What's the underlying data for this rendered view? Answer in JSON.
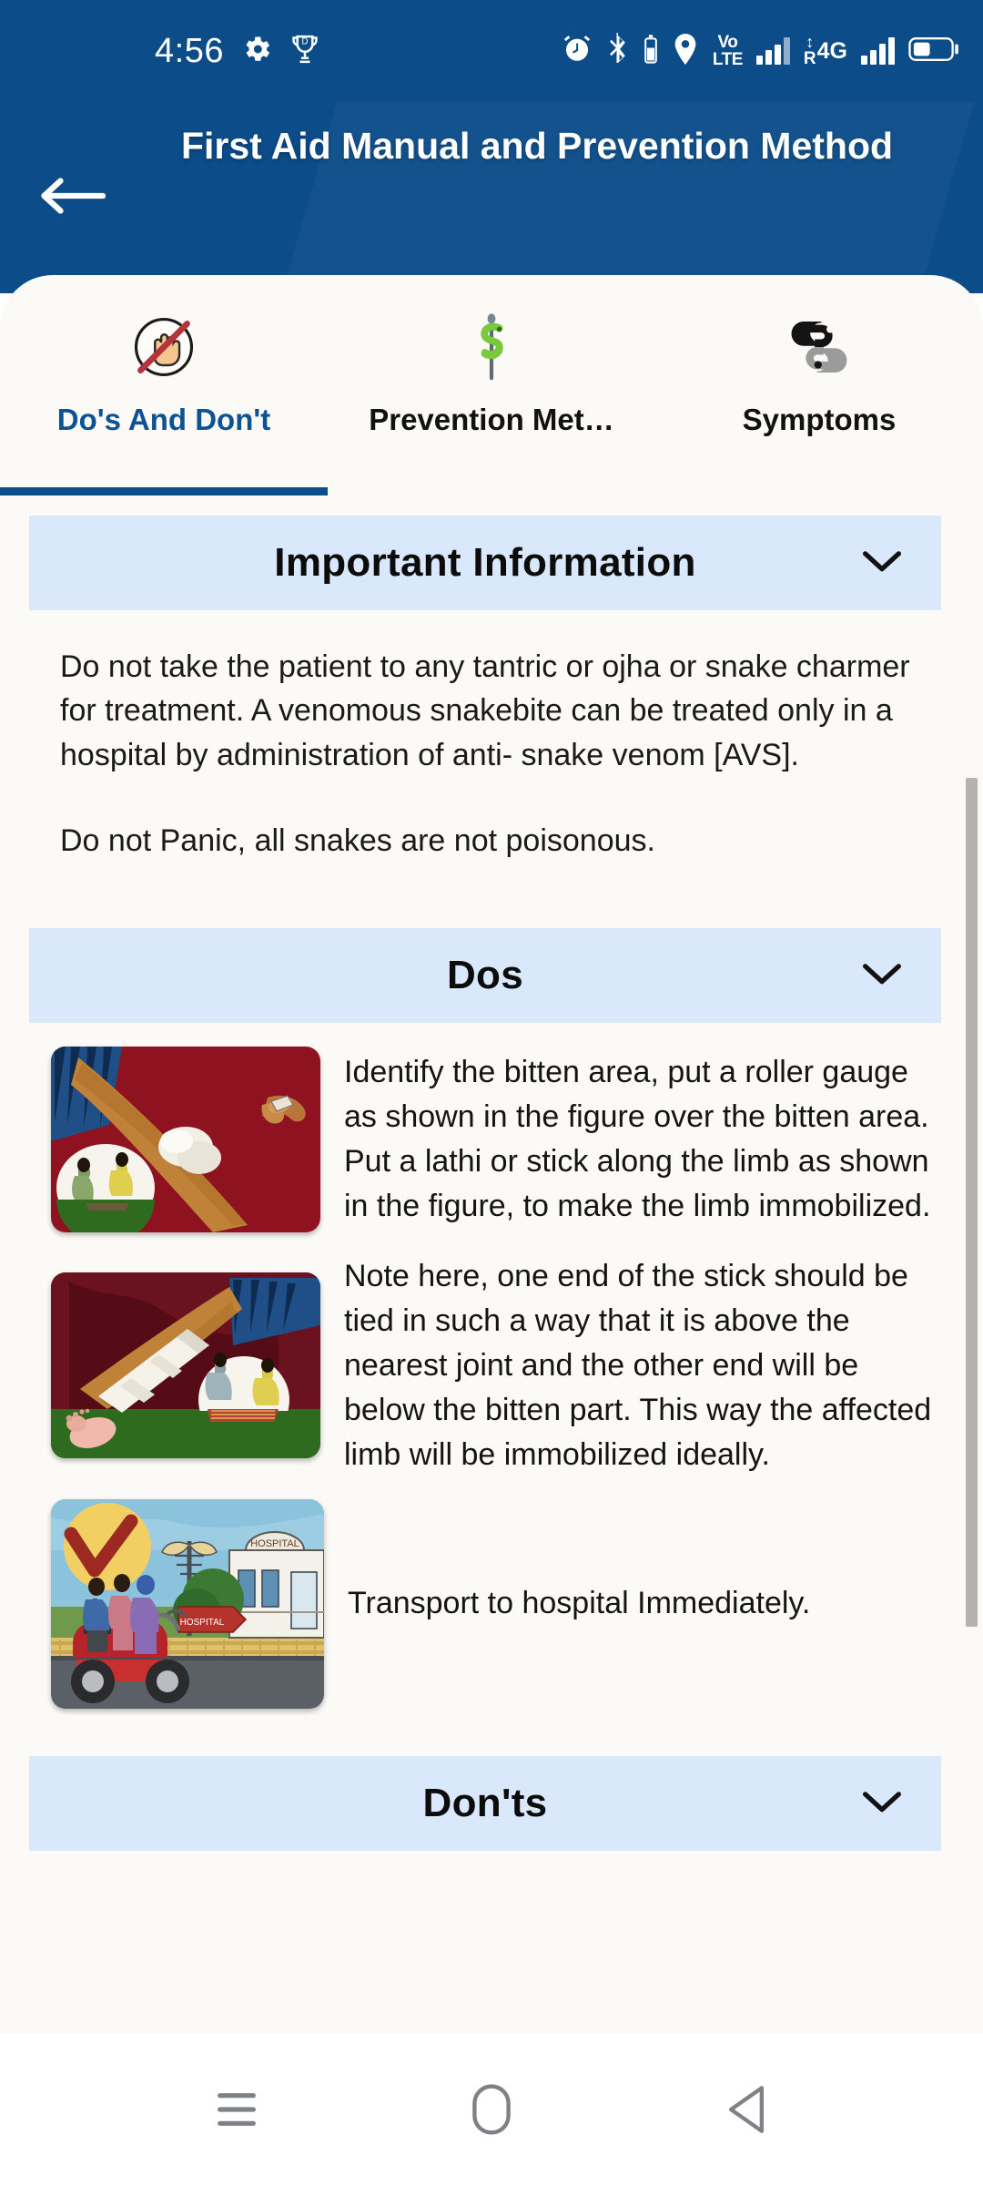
{
  "status_bar": {
    "time": "4:56",
    "left_icons": [
      "gear-icon",
      "trophy-icon"
    ],
    "right_icons": [
      "alarm-icon",
      "bluetooth-icon",
      "bt-battery-icon",
      "location-icon"
    ],
    "volte_line1": "Vo",
    "volte_line2": "LTE",
    "network_label": "4G",
    "roaming_label": "R",
    "battery_icon": "battery-icon"
  },
  "app_bar": {
    "back_icon": "back-arrow-icon",
    "title": "First Aid Manual and Prevention Method"
  },
  "tabs": [
    {
      "label": "Do's And Don't",
      "icon": "no-touch-hand-icon",
      "active": true
    },
    {
      "label": "Prevention Met…",
      "icon": "asclepius-staff-icon",
      "active": false
    },
    {
      "label": "Symptoms",
      "icon": "question-marks-icon",
      "active": false
    }
  ],
  "sections": {
    "important_information": {
      "title": "Important Information",
      "chevron": "chevron-down-icon",
      "paragraphs": [
        "Do not take the patient to any tantric or ojha or snake charmer for treatment. A venomous snakebite can be treated only in a hospital by administration of anti- snake venom [AVS].",
        "Do not Panic, all snakes are not poisonous."
      ]
    },
    "dos": {
      "title": "Dos",
      "chevron": "chevron-down-icon",
      "items": [
        {
          "image": "roller-gauge-on-arm-illustration",
          "text": "Identify the bitten area, put a roller gauge as shown in the figure over the bitten area. Put a lathi or stick along the limb as shown in the figure, to make the limb immobilized."
        },
        {
          "image": "splinted-bandaged-leg-illustration",
          "text": "Note here, one end of the stick should be tied in such a way that it is above the nearest joint and the other end will be below the bitten part. This way the affected limb will be immobilized ideally."
        },
        {
          "image": "scooter-to-hospital-illustration",
          "text": "Transport to hospital Immediately."
        }
      ]
    },
    "donts": {
      "title": "Don'ts",
      "chevron": "chevron-down-icon"
    }
  },
  "nav_bar": {
    "recents": "recents-icon",
    "home": "home-icon",
    "back": "back-triangle-icon"
  },
  "colors": {
    "brand_blue": "#0b4c89",
    "section_header_bg": "#d9e8fa",
    "active_tab_text": "#0d5293",
    "sheet_bg": "#fbfaf7",
    "scrollbar": "#b3b2b0"
  }
}
